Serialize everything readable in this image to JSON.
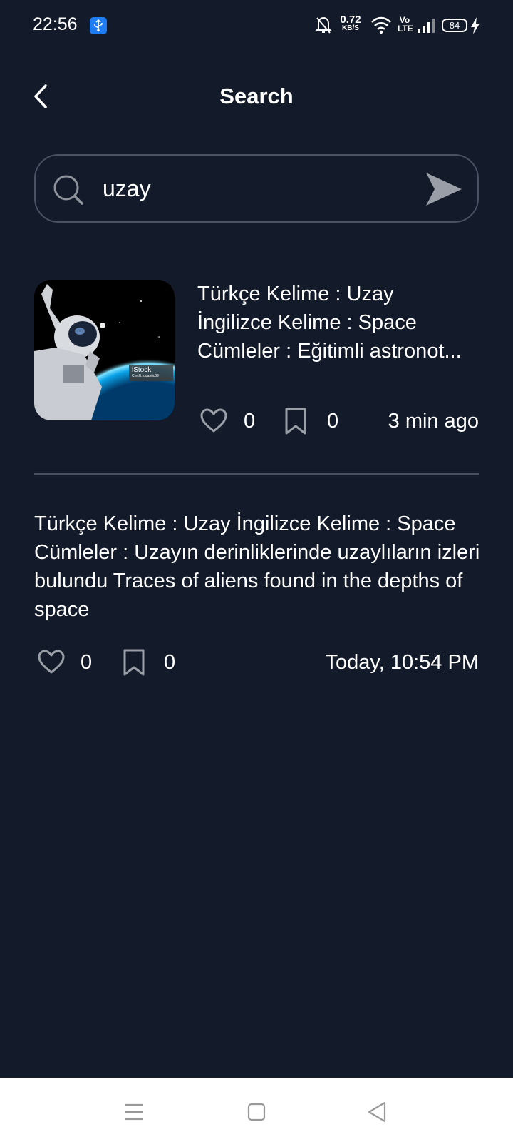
{
  "status_bar": {
    "time": "22:56",
    "usb_icon": "usb-icon",
    "net_speed_value": "0.72",
    "net_speed_unit": "KB/S",
    "volte": "Vo LTE",
    "battery": "84"
  },
  "header": {
    "title": "Search",
    "back_icon": "chevron-left-icon"
  },
  "search": {
    "value": "uzay",
    "search_icon": "search-icon",
    "send_icon": "send-icon"
  },
  "results": [
    {
      "has_image": true,
      "image_watermark": "iStock",
      "image_credit": "Credit: quantic69",
      "lines": [
        "Türkçe Kelime : Uzay",
        "İngilizce Kelime : Space",
        "Cümleler : Eğitimli astronot..."
      ],
      "likes": "0",
      "bookmarks": "0",
      "time": "3 min ago"
    },
    {
      "has_image": false,
      "text": "Türkçe Kelime : Uzay İngilizce Kelime : Space Cümleler : Uzayın derinliklerinde uzaylıların izleri bulundu Traces of aliens found in the depths of space",
      "likes": "0",
      "bookmarks": "0",
      "time": "Today, 10:54 PM"
    }
  ],
  "colors": {
    "background": "#131a29",
    "border": "#4a5163",
    "icon_grey": "#9a9ea6",
    "nav_background": "#ffffff"
  },
  "nav_bar": {
    "menu_icon": "menu-icon",
    "home_icon": "home-square-icon",
    "back_icon": "back-triangle-icon"
  }
}
